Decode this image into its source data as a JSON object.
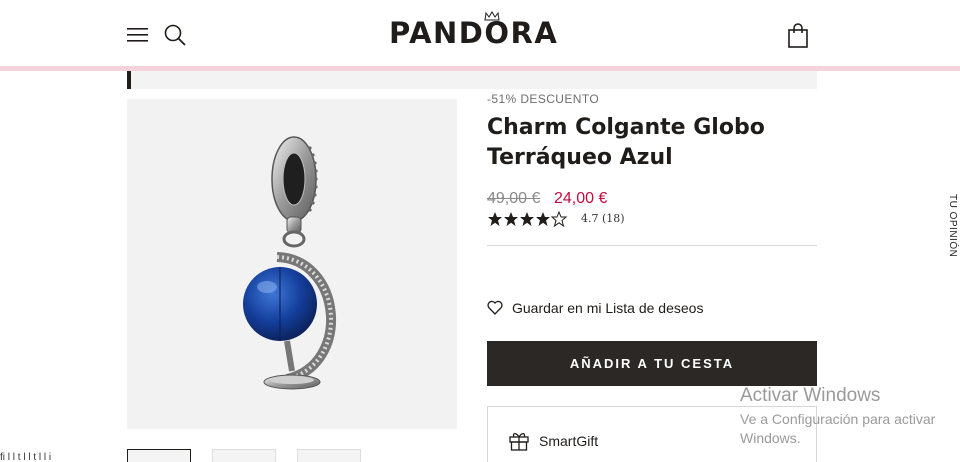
{
  "header": {
    "logo_text": "PANDORA",
    "menu_icon": "hamburger-menu-icon",
    "search_icon": "search-icon",
    "bag_icon": "shopping-bag-icon",
    "accent_line_color": "#f6d2dc"
  },
  "product": {
    "discount_label": "-51% DESCUENTO",
    "title": "Charm Colgante Globo Terráqueo Azul",
    "price_old": "49,00 €",
    "price_new": "24,00 €",
    "price_new_color": "#c00c40",
    "rating": 4.7,
    "rating_text": "4.7  (18)",
    "stars_filled": 4.5,
    "stars_total": 5,
    "image_alt": "charm globe blue pendant"
  },
  "actions": {
    "wishlist_label": "Guardar en mi Lista de deseos",
    "add_to_cart_label": "AÑADIR A TU CESTA",
    "smartgift_label": "SmartGift"
  },
  "feedback_tab": {
    "label": "TU OPINIÓN"
  },
  "os_watermark": {
    "title": "Activar Windows",
    "subtitle": "Ve a Configuración para activar Windows."
  },
  "cookie_banner_fragment": {
    "text": "fi     l       l t     l   l     t   l   l          i"
  }
}
